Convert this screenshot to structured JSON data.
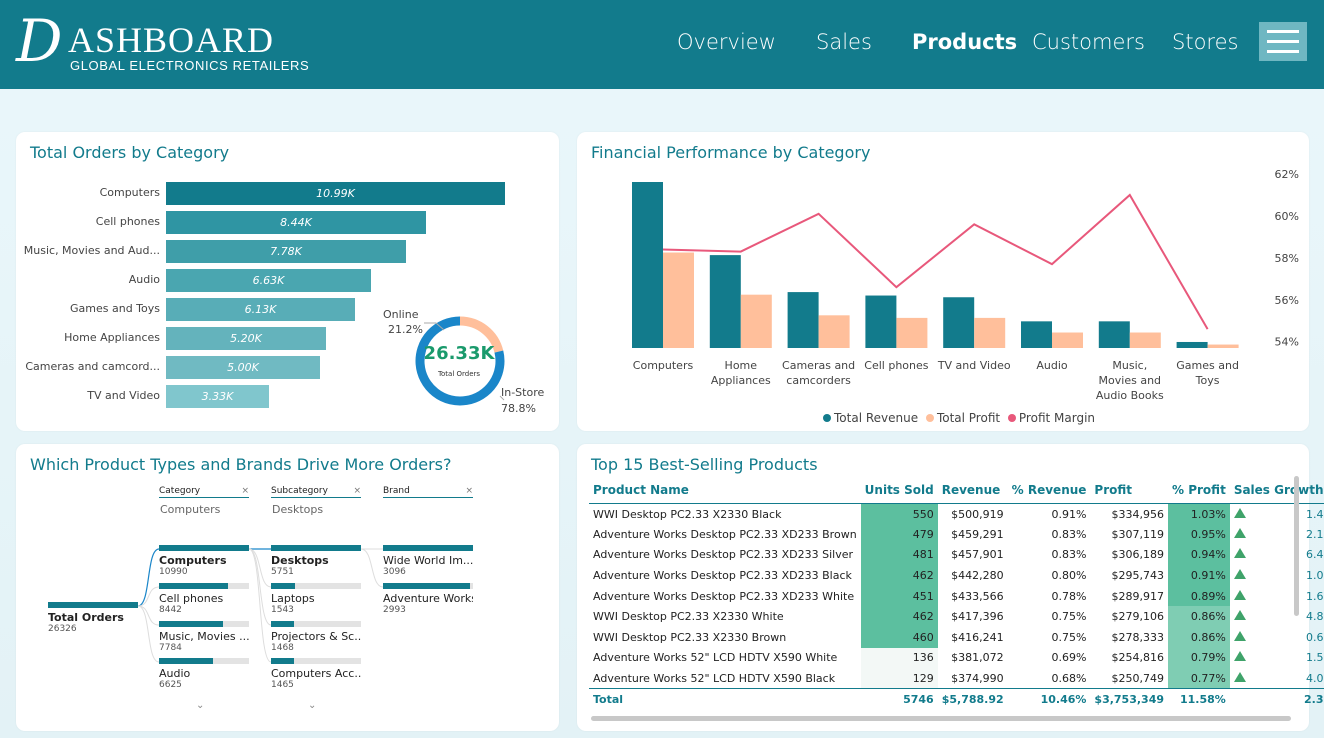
{
  "header": {
    "logo_initial": "D",
    "logo_word": "ASHBOARD",
    "logo_subtitle": "GLOBAL ELECTRONICS RETAILERS",
    "nav": [
      "Overview",
      "Sales",
      "Products",
      "Customers",
      "Stores"
    ],
    "active_nav": "Products",
    "menu_icon": "hamburger-menu-icon"
  },
  "colors": {
    "brand": "#127b8c",
    "revenue": "#127b8c",
    "profit": "#ffbf9b",
    "margin_line": "#e8587b",
    "donut_online": "#ffbf9b",
    "donut_instore": "#1a86c9"
  },
  "orders_by_category": {
    "title": "Total Orders by Category",
    "chart_data": {
      "type": "bar",
      "categories": [
        "Computers",
        "Cell phones",
        "Music, Movies and Aud...",
        "Audio",
        "Games and Toys",
        "Home Appliances",
        "Cameras and camcord...",
        "TV and Video"
      ],
      "values": [
        10.99,
        8.44,
        7.78,
        6.63,
        6.13,
        5.2,
        5.0,
        3.33
      ],
      "value_labels": [
        "10.99K",
        "8.44K",
        "7.78K",
        "6.63K",
        "6.13K",
        "5.20K",
        "5.00K",
        "3.33K"
      ]
    },
    "donut": {
      "total": "26.33K",
      "total_label": "Total Orders",
      "segments": [
        {
          "name": "Online",
          "pct": "21.2%",
          "value": 21.2
        },
        {
          "name": "In-Store",
          "pct": "78.8%",
          "value": 78.8
        }
      ]
    }
  },
  "financial": {
    "title": "Financial Performance by Category",
    "chart_data": {
      "type": "bar",
      "categories": [
        "Computers",
        "Home Appliances",
        "Cameras and camcorders",
        "Cell phones",
        "TV and Video",
        "Audio",
        "Music, Movies and Audio Books",
        "Games and Toys"
      ],
      "series": [
        {
          "name": "Total Revenue",
          "values": [
            19.3,
            10.8,
            6.5,
            6.1,
            5.9,
            3.1,
            3.1,
            0.7
          ]
        },
        {
          "name": "Total Profit",
          "values": [
            11.1,
            6.2,
            3.8,
            3.5,
            3.5,
            1.8,
            1.8,
            0.4
          ]
        },
        {
          "name": "Profit Margin",
          "values": [
            58.4,
            58.3,
            60.1,
            56.6,
            59.6,
            57.7,
            61.0,
            54.6
          ]
        }
      ],
      "y2_ticks": [
        "62%",
        "60%",
        "58%",
        "56%",
        "54%"
      ],
      "y2lim": [
        53.7,
        62.0
      ]
    },
    "legend": [
      "Total Revenue",
      "Total Profit",
      "Profit Margin"
    ]
  },
  "decomp": {
    "title": "Which Product Types and Brands Drive More Orders?",
    "columns": [
      {
        "header": "Category",
        "selected": "Computers"
      },
      {
        "header": "Subcategory",
        "selected": "Desktops"
      },
      {
        "header": "Brand",
        "selected": ""
      }
    ],
    "root": {
      "name": "Total Orders",
      "value": "26326"
    },
    "category": [
      {
        "name": "Computers",
        "value": "10990",
        "fill": 1.0
      },
      {
        "name": "Cell phones",
        "value": "8442",
        "fill": 0.77
      },
      {
        "name": "Music, Movies ...",
        "value": "7784",
        "fill": 0.71
      },
      {
        "name": "Audio",
        "value": "6625",
        "fill": 0.6
      }
    ],
    "subcategory": [
      {
        "name": "Desktops",
        "value": "5751",
        "fill": 1.0
      },
      {
        "name": "Laptops",
        "value": "1543",
        "fill": 0.27
      },
      {
        "name": "Projectors & Sc...",
        "value": "1468",
        "fill": 0.26
      },
      {
        "name": "Computers Acc...",
        "value": "1465",
        "fill": 0.25
      }
    ],
    "brand": [
      {
        "name": "Wide World Im...",
        "value": "3096",
        "fill": 1.0
      },
      {
        "name": "Adventure Works",
        "value": "2993",
        "fill": 0.97
      }
    ]
  },
  "top_products": {
    "title": "Top 15 Best-Selling Products",
    "columns": [
      "Product Name",
      "Units Sold",
      "Revenue",
      "% Revenue",
      "Profit",
      "% Profit",
      "Sales Growth"
    ],
    "rows": [
      [
        "WWI Desktop PC2.33 X2330 Black",
        "550",
        "$500,919",
        "0.91%",
        "$334,956",
        "1.03%",
        "1.4"
      ],
      [
        "Adventure Works Desktop PC2.33 XD233 Brown",
        "479",
        "$459,291",
        "0.83%",
        "$307,119",
        "0.95%",
        "2.1"
      ],
      [
        "Adventure Works Desktop PC2.33 XD233 Silver",
        "481",
        "$457,901",
        "0.83%",
        "$306,189",
        "0.94%",
        "6.4"
      ],
      [
        "Adventure Works Desktop PC2.33 XD233 Black",
        "462",
        "$442,280",
        "0.80%",
        "$295,743",
        "0.91%",
        "1.0"
      ],
      [
        "Adventure Works Desktop PC2.33 XD233 White",
        "451",
        "$433,566",
        "0.78%",
        "$289,917",
        "0.89%",
        "1.6"
      ],
      [
        "WWI Desktop PC2.33 X2330 White",
        "462",
        "$417,396",
        "0.75%",
        "$279,106",
        "0.86%",
        "4.8"
      ],
      [
        "WWI Desktop PC2.33 X2330 Brown",
        "460",
        "$416,241",
        "0.75%",
        "$278,333",
        "0.86%",
        "0.6"
      ],
      [
        "Adventure Works 52\" LCD HDTV X590 White",
        "136",
        "$381,072",
        "0.69%",
        "$254,816",
        "0.79%",
        "1.5"
      ],
      [
        "Adventure Works 52\" LCD HDTV X590 Black",
        "129",
        "$374,990",
        "0.68%",
        "$250,749",
        "0.77%",
        "4.0"
      ]
    ],
    "total": [
      "Total",
      "5746",
      "$5,788.92",
      "10.46%",
      "$3,753,349",
      "11.58%",
      "2.3"
    ]
  }
}
